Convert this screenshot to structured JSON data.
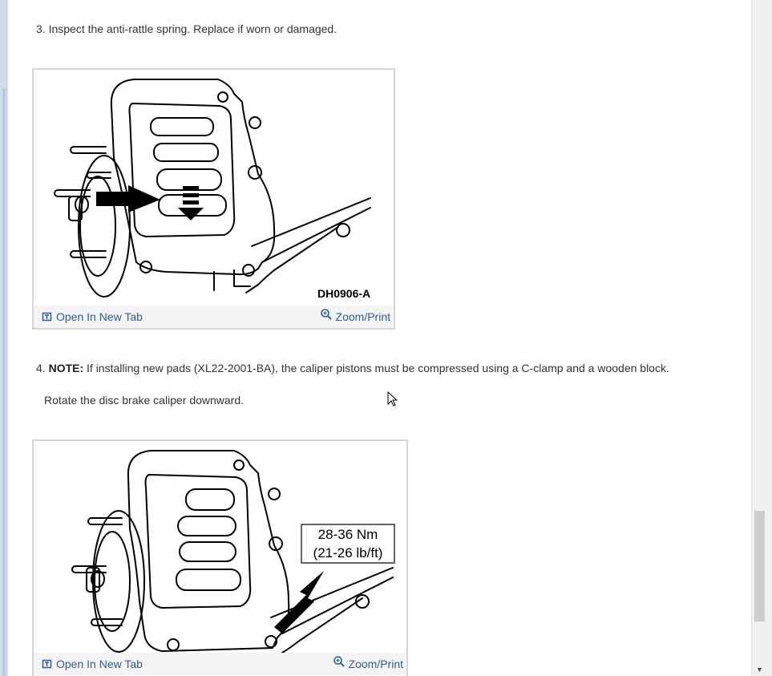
{
  "steps": [
    {
      "number": "3.",
      "text": "Inspect the anti-rattle spring. Replace if worn or damaged."
    },
    {
      "number": "4.",
      "note_label": "NOTE:",
      "text": "If installing new pads (XL22-2001-BA), the caliper pistons must be compressed using a C-clamp and a wooden block."
    },
    {
      "text": "Rotate the disc brake caliper downward."
    }
  ],
  "figures": [
    {
      "caption_code": "DH0906-A",
      "open_label": "Open In New Tab",
      "zoom_label": "Zoom/Print"
    },
    {
      "torque_line1": "28-36 Nm",
      "torque_line2": "(21-26 lb/ft)",
      "open_label": "Open In New Tab",
      "zoom_label": "Zoom/Print"
    }
  ],
  "icons": {
    "open": "open-new-tab-icon",
    "zoom": "magnifier-icon",
    "cursor": "mouse-pointer-icon"
  },
  "colors": {
    "link": "#2e5e93",
    "text": "#333333",
    "frame": "#cfdbe8"
  }
}
